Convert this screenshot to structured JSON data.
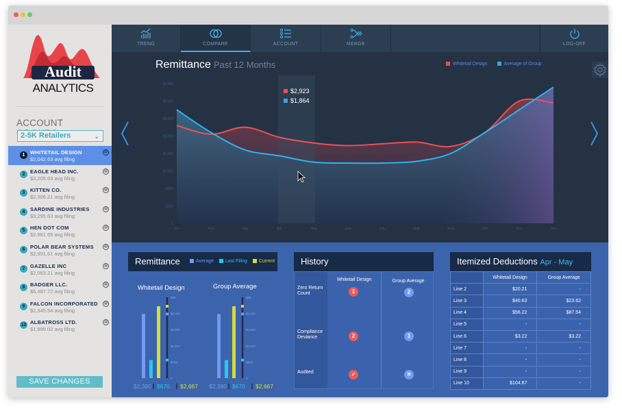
{
  "window": {
    "traffic_lights": [
      "#ee5f5b",
      "#e9c237",
      "#5fcf74"
    ]
  },
  "sidebar": {
    "logo": {
      "line1": "Audit",
      "line2": "ANALYTICS"
    },
    "section_title": "ACCOUNT GROUPS",
    "group_select": {
      "value": "2-5K Retailers",
      "icon": "chevron-down-icon"
    },
    "accounts": [
      {
        "num": "1",
        "name": "WHITETAIL DESIGN",
        "sub": "$2,042.63 avg filing",
        "active": true
      },
      {
        "num": "2",
        "name": "EAGLE HEAD INC.",
        "sub": "$3,205.63 avg filing"
      },
      {
        "num": "3",
        "name": "KITTEN CO.",
        "sub": "$2,306.21 avg filing"
      },
      {
        "num": "4",
        "name": "SARDINE INDUSTRIES",
        "sub": "$3,295.63 avg filing"
      },
      {
        "num": "5",
        "name": "HEN DOT COM",
        "sub": "$2,981.65 avg filing"
      },
      {
        "num": "6",
        "name": "POLAR BEAR SYSTEMS",
        "sub": "$2,991.61 avg filing"
      },
      {
        "num": "7",
        "name": "GAZELLE INC",
        "sub": "$2,083.21 avg filing"
      },
      {
        "num": "8",
        "name": "BADGER LLC.",
        "sub": "$5,487.72 avg filing"
      },
      {
        "num": "9",
        "name": "FALCON INCORPORATED",
        "sub": "$2,345.54 avg filing"
      },
      {
        "num": "10",
        "name": "ALBATROSS LTD.",
        "sub": "$1,999.02 avg filing"
      }
    ],
    "remove_icon": "⊗",
    "save_label": "SAVE CHANGES"
  },
  "nav": {
    "items": [
      {
        "label": "TREND",
        "icon": "trend-chart-icon"
      },
      {
        "label": "COMPARE",
        "icon": "compare-circles-icon",
        "active": true
      },
      {
        "label": "ACCOUNT",
        "icon": "list-icon"
      },
      {
        "label": "MERGE",
        "icon": "merge-icon"
      },
      {
        "label": "LOG-OFF",
        "icon": "power-icon"
      }
    ]
  },
  "colors": {
    "whitetail": "#ef4f55",
    "group": "#3aa2f0",
    "average": "#6f9cf0",
    "last_filing": "#2ec5ef",
    "current": "#d8db3a",
    "accent": "#3fb3e6"
  },
  "chart_data": [
    {
      "type": "area",
      "title": "Remittance",
      "subtitle": "Past 12 Months",
      "categories": [
        "Jan",
        "Feb",
        "Mar",
        "Apr",
        "May",
        "June",
        "July",
        "Aug",
        "Sept",
        "Oct",
        "Nov",
        "Dec"
      ],
      "y_ticks": [
        "$6,000",
        "$5,000",
        "$4,000",
        "$3,000",
        "$2,000",
        "$1,000",
        "$500",
        "$250",
        "0"
      ],
      "y_tick_values": [
        6000,
        5000,
        4000,
        3000,
        2000,
        1000,
        500,
        250,
        0
      ],
      "series": [
        {
          "name": "Whitetail Design",
          "values": [
            3600,
            3100,
            3500,
            2923,
            2600,
            2450,
            2550,
            2650,
            2400,
            3200,
            5000,
            4900
          ]
        },
        {
          "name": "Average of Group",
          "values": [
            4500,
            3200,
            2200,
            1864,
            1500,
            1450,
            1450,
            1550,
            2000,
            3200,
            4500,
            5800
          ]
        }
      ],
      "legend": "top-right",
      "tooltip": {
        "category": "Apr",
        "values": [
          "$2,923",
          "$1,864"
        ]
      },
      "highlight_category": "Apr"
    },
    {
      "type": "bar",
      "title": "Remittance",
      "legend": [
        "Average",
        "Last Filing",
        "Current"
      ],
      "y_ticks": [
        "$3K",
        "$2,400",
        "$1,800",
        "$1,200",
        "$600",
        "0"
      ],
      "ylim": [
        0,
        3000
      ],
      "groups": [
        {
          "name": "Whitetail Design",
          "values": [
            2380,
            670,
            2667
          ],
          "labels": [
            "$2,380",
            "$670",
            "$2,667"
          ]
        },
        {
          "name": "Group Average",
          "values": [
            2380,
            670,
            2667
          ],
          "labels": [
            "$2,380",
            "$670",
            "$2,667"
          ]
        }
      ]
    }
  ],
  "history": {
    "title": "History",
    "columns": [
      "Whitetail Design",
      "Group Average"
    ],
    "rows": [
      {
        "label": "Zero Return Count",
        "whitetail": "1",
        "group": "2"
      },
      {
        "label": "Compliance Deviance",
        "whitetail": "2",
        "group": "1"
      },
      {
        "label": "Audited",
        "whitetail": "✓",
        "group": "✕"
      }
    ]
  },
  "deductions": {
    "title": "Itemized Deductions",
    "period": "Apr - May",
    "columns": [
      "Whitetail Design",
      "Group Average"
    ],
    "rows": [
      {
        "label": "Line 2",
        "whitetail": "$20.21",
        "group": "-"
      },
      {
        "label": "Line 3",
        "whitetail": "$40.63",
        "group": "$23.62"
      },
      {
        "label": "Line 4",
        "whitetail": "$56.22",
        "group": "$87.54"
      },
      {
        "label": "Line 5",
        "whitetail": "-",
        "group": "-"
      },
      {
        "label": "Line 6",
        "whitetail": "$3.22",
        "group": "$3.22"
      },
      {
        "label": "Line 7",
        "whitetail": "-",
        "group": "-"
      },
      {
        "label": "Line 8",
        "whitetail": "-",
        "group": "-"
      },
      {
        "label": "Line 9",
        "whitetail": "-",
        "group": "-"
      },
      {
        "label": "Line 10",
        "whitetail": "$104.67",
        "group": "-"
      }
    ]
  }
}
